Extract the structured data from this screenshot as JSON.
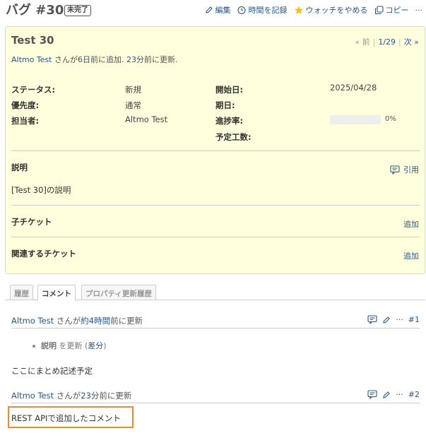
{
  "header": {
    "title": "バグ #30",
    "status_badge": "未完了",
    "actions": {
      "edit": "編集",
      "log_time": "時間を記録",
      "unwatch": "ウォッチをやめる",
      "copy": "コピー",
      "more": "···"
    }
  },
  "issue": {
    "subject": "Test 30",
    "pager": {
      "prev": "« 前",
      "position": "1/29",
      "next": "次 »"
    },
    "author": {
      "name": "Altmo Test",
      "added_mid": " さんが",
      "added_ago": "6日",
      "added_suffix": "前に追加.",
      "updated_ago": "23分",
      "updated_suffix": "前に更新."
    },
    "attributes": {
      "status_label": "ステータス:",
      "status_value": "新規",
      "priority_label": "優先度:",
      "priority_value": "通常",
      "assignee_label": "担当者:",
      "assignee_value": "Altmo Test",
      "start_label": "開始日:",
      "start_value": "2025/04/28",
      "due_label": "期日:",
      "done_label": "進捗率:",
      "done_value": "0%",
      "done_ratio": 0,
      "estimated_label": "予定工数:"
    },
    "description": {
      "title": "説明",
      "quote": "引用",
      "text": "[Test 30]の説明"
    },
    "subtasks": {
      "title": "子チケット",
      "add": "追加"
    },
    "relations": {
      "title": "関連するチケット",
      "add": "追加"
    }
  },
  "tabs": [
    "履歴",
    "コメント",
    "プロパティ更新履歴"
  ],
  "active_tab": "コメント",
  "journals": [
    {
      "author": "Altmo Test",
      "mid": " さんが",
      "ago": "約4時間",
      "suffix": "前に更新",
      "number": "#1",
      "detail_field": "説明",
      "detail_text": " を更新 (",
      "detail_link": "差分",
      "detail_end": ")",
      "note": "ここにまとめ記述予定"
    },
    {
      "author": "Altmo Test",
      "mid": " さんが",
      "ago": "23分",
      "suffix": "前に更新",
      "number": "#2",
      "note": "REST APIで追加したコメント"
    }
  ],
  "colors": {
    "issue_bg": "#ffffdd",
    "link": "#2a5685",
    "highlight": "#f08a2a",
    "watch_star": "#f0c419"
  },
  "icons": [
    "pencil-icon",
    "clock-plus-icon",
    "star-icon",
    "copy-icon",
    "ellipsis-icon",
    "comment-icon"
  ]
}
